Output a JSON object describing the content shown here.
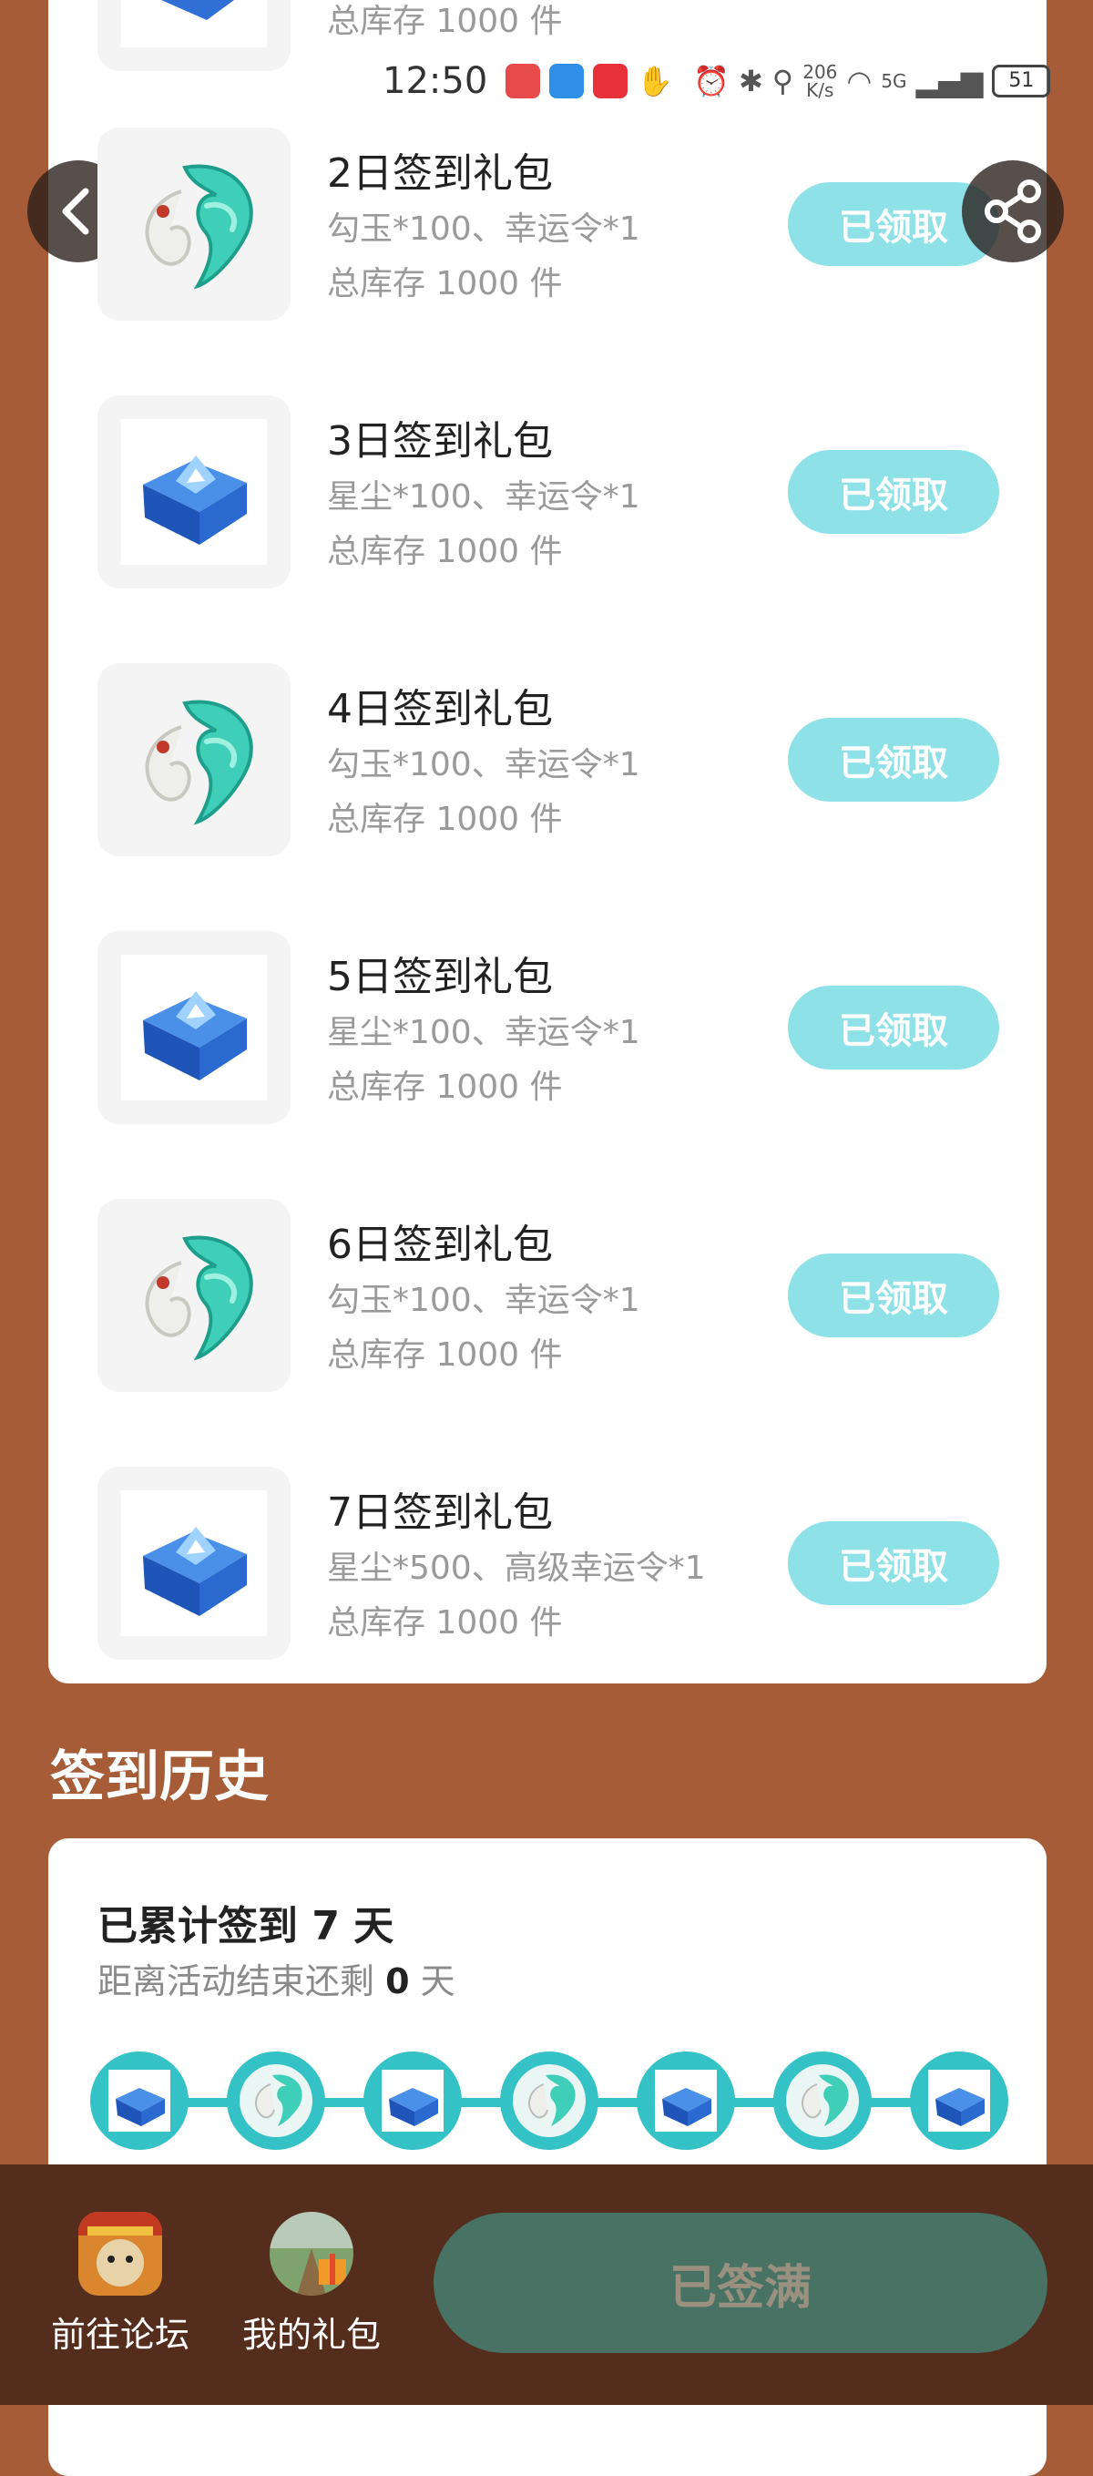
{
  "status_bar": {
    "time": "12:50",
    "net_speed_value": "206",
    "net_speed_unit": "K/s",
    "signal_label": "5G",
    "battery": "51"
  },
  "top_partial": {
    "stock": "总库存 1000 件"
  },
  "gifts": [
    {
      "title": "2日签到礼包",
      "desc": "勾玉*100、幸运令*1",
      "stock": "总库存 1000 件",
      "button": "已领取",
      "icon": "magatama-jade-icon"
    },
    {
      "title": "3日签到礼包",
      "desc": "星尘*100、幸运令*1",
      "stock": "总库存 1000 件",
      "button": "已领取",
      "icon": "crystal-chest-icon"
    },
    {
      "title": "4日签到礼包",
      "desc": "勾玉*100、幸运令*1",
      "stock": "总库存 1000 件",
      "button": "已领取",
      "icon": "magatama-jade-icon"
    },
    {
      "title": "5日签到礼包",
      "desc": "星尘*100、幸运令*1",
      "stock": "总库存 1000 件",
      "button": "已领取",
      "icon": "crystal-chest-icon"
    },
    {
      "title": "6日签到礼包",
      "desc": "勾玉*100、幸运令*1",
      "stock": "总库存 1000 件",
      "button": "已领取",
      "icon": "magatama-jade-icon"
    },
    {
      "title": "7日签到礼包",
      "desc": "星尘*500、高级幸运令*1",
      "stock": "总库存 1000 件",
      "button": "已领取",
      "icon": "crystal-chest-icon"
    }
  ],
  "history": {
    "title": "签到历史",
    "count_text": "已累计签到 7 天",
    "remain_prefix": "距离活动结束还剩",
    "remain_days": "0",
    "remain_suffix": "天"
  },
  "timeline_icons": [
    "crystal-chest-icon",
    "magatama-jade-icon",
    "crystal-chest-icon",
    "magatama-jade-icon",
    "crystal-chest-icon",
    "magatama-jade-icon",
    "crystal-chest-icon"
  ],
  "bottom_bar": {
    "forum_label": "前往论坛",
    "my_gifts_label": "我的礼包",
    "signed_button": "已签满"
  },
  "colors": {
    "page_bg": "#a65d37",
    "claimed_button": "#8ee2e7",
    "timeline": "#35c2c7",
    "bottom_bar": "#552d1c",
    "signed_button": "#477264"
  }
}
